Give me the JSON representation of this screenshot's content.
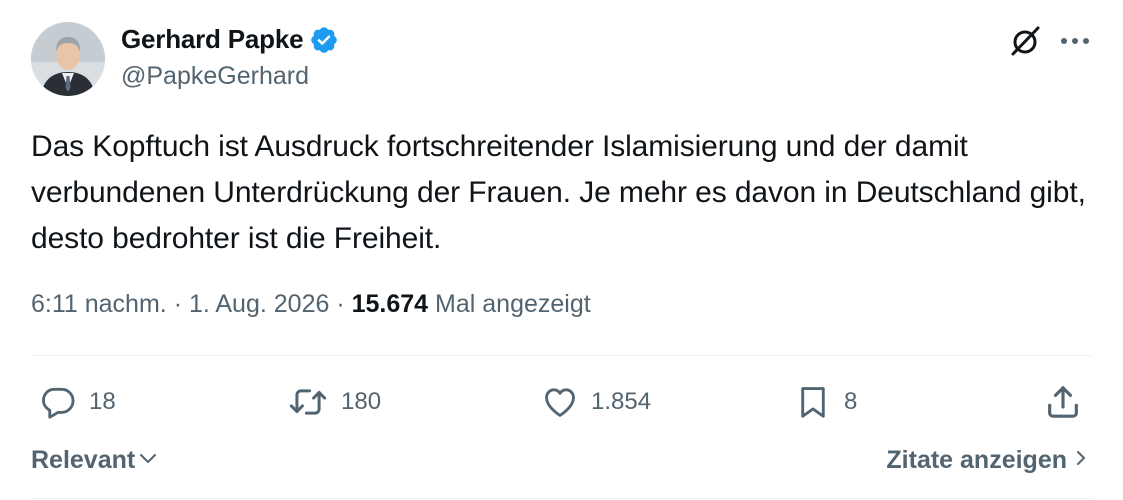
{
  "author": {
    "display_name": "Gerhard Papke",
    "handle": "@PapkeGerhard",
    "verified": true,
    "avatar_icon": "profile-photo"
  },
  "tweet": {
    "text": "Das Kopftuch ist Ausdruck fortschreitender Islamisierung und der damit verbundenen Unterdrückung der Frauen. Je mehr es davon in Deutschland gibt, desto bedrohter ist die Freiheit.",
    "time": "6:11 nachm.",
    "sep1": "·",
    "date": "1. Aug. 2026",
    "sep2": "·",
    "views": "15.674",
    "views_label": "Mal angezeigt"
  },
  "actions": {
    "replies": "18",
    "reposts": "180",
    "likes": "1.854",
    "bookmarks": "8"
  },
  "footer": {
    "sort_label": "Relevant",
    "quotes_label": "Zitate anzeigen"
  },
  "colors": {
    "text": "#0f1419",
    "secondary": "#536471",
    "verified": "#1d9bf0",
    "divider": "#eff3f4"
  },
  "icons": [
    "verified-badge-icon",
    "grok-icon",
    "more-icon",
    "reply-icon",
    "repost-icon",
    "like-icon",
    "bookmark-icon",
    "share-icon",
    "chevron-down-icon",
    "chevron-right-icon"
  ]
}
